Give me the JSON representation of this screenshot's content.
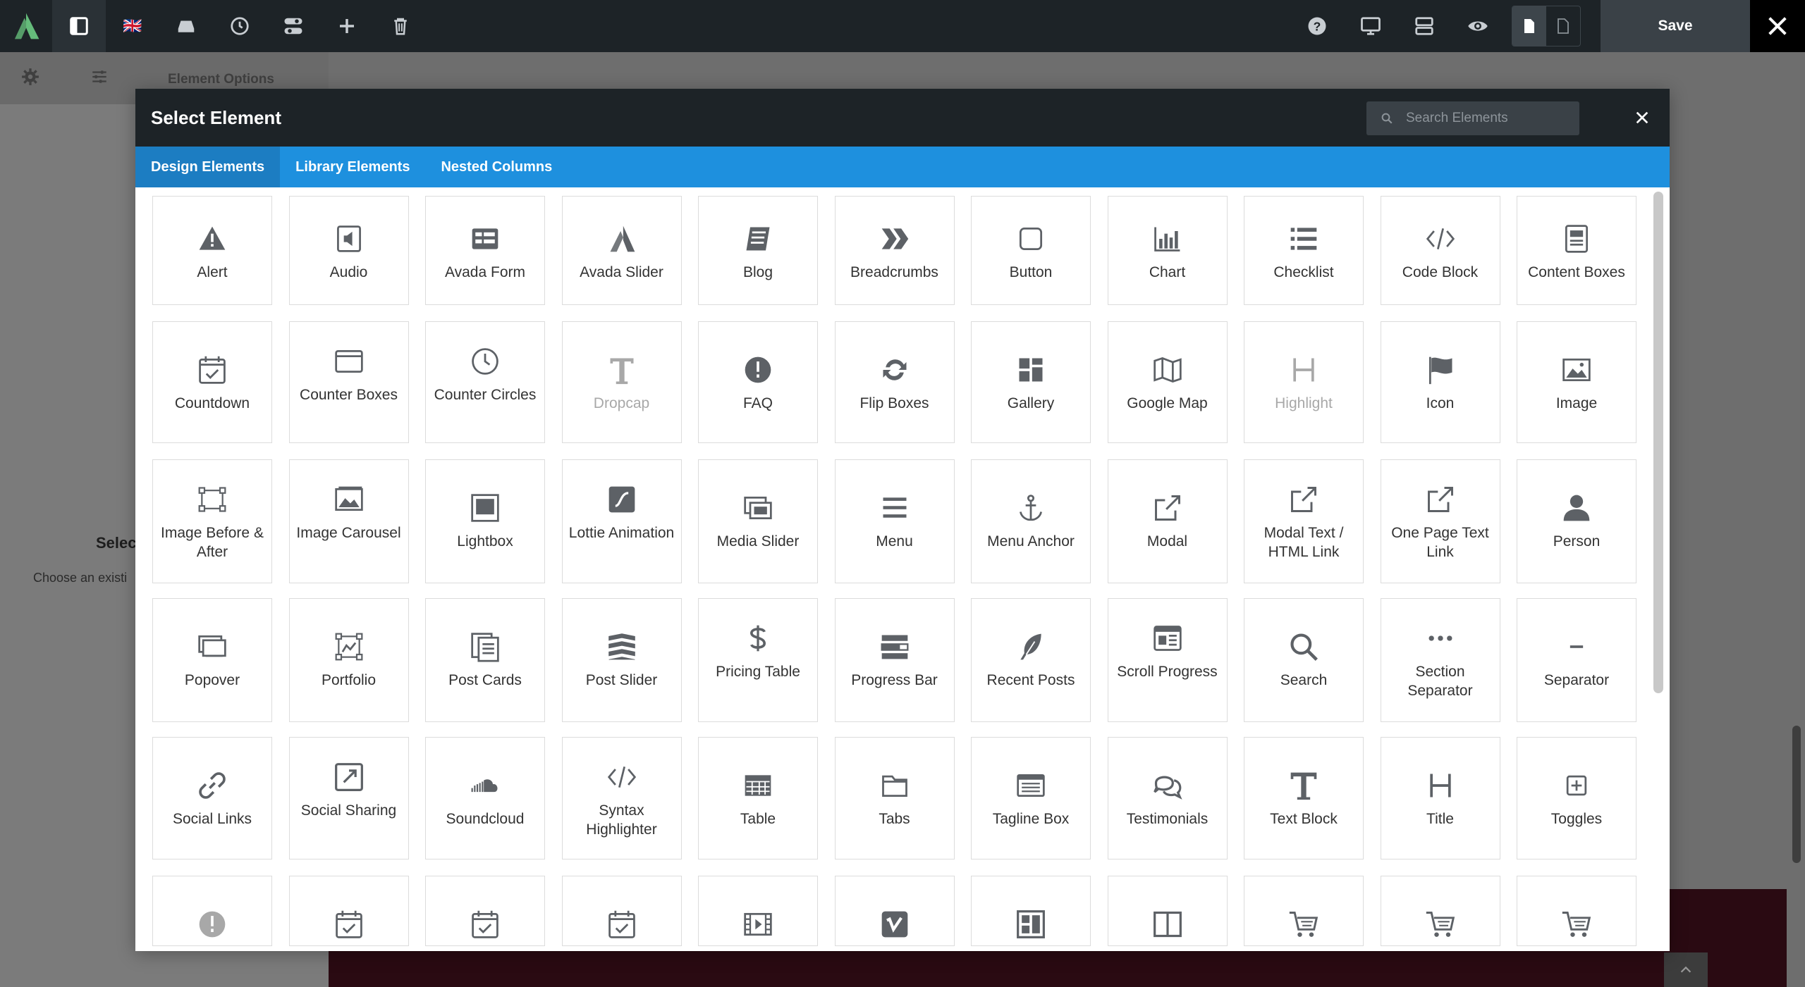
{
  "toolbar": {
    "language": "🇬🇧",
    "save_label": "Save"
  },
  "background": {
    "element_options_label": "Element Options",
    "select_heading": "Selec",
    "choose_text": "Choose an existi"
  },
  "modal": {
    "title": "Select Element",
    "search_placeholder": "Search Elements",
    "tabs": [
      "Design Elements",
      "Library Elements",
      "Nested Columns"
    ],
    "elements": [
      {
        "label": "Alert",
        "icon": "alert-icon"
      },
      {
        "label": "Audio",
        "icon": "audio-icon"
      },
      {
        "label": "Avada Form",
        "icon": "form-icon"
      },
      {
        "label": "Avada Slider",
        "icon": "avada-logo-icon"
      },
      {
        "label": "Blog",
        "icon": "blog-icon"
      },
      {
        "label": "Breadcrumbs",
        "icon": "breadcrumbs-icon"
      },
      {
        "label": "Button",
        "icon": "button-icon"
      },
      {
        "label": "Chart",
        "icon": "chart-icon"
      },
      {
        "label": "Checklist",
        "icon": "checklist-icon"
      },
      {
        "label": "Code Block",
        "icon": "code-icon"
      },
      {
        "label": "Content Boxes",
        "icon": "content-boxes-icon"
      },
      {
        "label": "Countdown",
        "icon": "calendar-check-icon"
      },
      {
        "label": "Counter Boxes",
        "icon": "window-icon"
      },
      {
        "label": "Counter Circles",
        "icon": "clock-icon"
      },
      {
        "label": "Dropcap",
        "icon": "dropcap-icon",
        "muted": true
      },
      {
        "label": "FAQ",
        "icon": "exclamation-circle-icon"
      },
      {
        "label": "Flip Boxes",
        "icon": "flip-icon"
      },
      {
        "label": "Gallery",
        "icon": "gallery-icon"
      },
      {
        "label": "Google Map",
        "icon": "map-icon"
      },
      {
        "label": "Highlight",
        "icon": "heading-icon",
        "muted": true
      },
      {
        "label": "Icon",
        "icon": "flag-icon"
      },
      {
        "label": "Image",
        "icon": "image-icon"
      },
      {
        "label": "Image Before & After",
        "icon": "before-after-icon"
      },
      {
        "label": "Image Carousel",
        "icon": "image-carousel-icon"
      },
      {
        "label": "Lightbox",
        "icon": "lightbox-icon"
      },
      {
        "label": "Lottie Animation",
        "icon": "lottie-icon"
      },
      {
        "label": "Media Slider",
        "icon": "media-slider-icon"
      },
      {
        "label": "Menu",
        "icon": "menu-icon"
      },
      {
        "label": "Menu Anchor",
        "icon": "anchor-icon"
      },
      {
        "label": "Modal",
        "icon": "external-link-icon"
      },
      {
        "label": "Modal Text / HTML Link",
        "icon": "external-link-icon"
      },
      {
        "label": "One Page Text Link",
        "icon": "external-link-icon"
      },
      {
        "label": "Person",
        "icon": "person-icon"
      },
      {
        "label": "Popover",
        "icon": "popover-icon"
      },
      {
        "label": "Portfolio",
        "icon": "portfolio-icon"
      },
      {
        "label": "Post Cards",
        "icon": "post-cards-icon"
      },
      {
        "label": "Post Slider",
        "icon": "post-slider-icon"
      },
      {
        "label": "Pricing Table",
        "icon": "dollar-icon"
      },
      {
        "label": "Progress Bar",
        "icon": "progress-bar-icon"
      },
      {
        "label": "Recent Posts",
        "icon": "feather-icon"
      },
      {
        "label": "Scroll Progress",
        "icon": "scroll-progress-icon"
      },
      {
        "label": "Search",
        "icon": "search-icon"
      },
      {
        "label": "Section Separator",
        "icon": "dots-icon"
      },
      {
        "label": "Separator",
        "icon": "minus-icon"
      },
      {
        "label": "Social Links",
        "icon": "link-icon"
      },
      {
        "label": "Social Sharing",
        "icon": "share-icon"
      },
      {
        "label": "Soundcloud",
        "icon": "soundcloud-icon"
      },
      {
        "label": "Syntax Highlighter",
        "icon": "code-icon"
      },
      {
        "label": "Table",
        "icon": "table-icon"
      },
      {
        "label": "Tabs",
        "icon": "folder-icon"
      },
      {
        "label": "Tagline Box",
        "icon": "tagline-icon"
      },
      {
        "label": "Testimonials",
        "icon": "comments-icon"
      },
      {
        "label": "Text Block",
        "icon": "text-icon"
      },
      {
        "label": "Title",
        "icon": "heading-icon"
      },
      {
        "label": "Toggles",
        "icon": "plus-square-icon"
      },
      {
        "label": "",
        "icon": "exclamation-circle-icon",
        "muted": true
      },
      {
        "label": "",
        "icon": "calendar-check-icon"
      },
      {
        "label": "",
        "icon": "calendar-check-icon"
      },
      {
        "label": "",
        "icon": "calendar-check-icon"
      },
      {
        "label": "",
        "icon": "video-icon"
      },
      {
        "label": "",
        "icon": "vimeo-icon"
      },
      {
        "label": "",
        "icon": "layout-icon"
      },
      {
        "label": "",
        "icon": "columns-icon"
      },
      {
        "label": "",
        "icon": "cart-icon"
      },
      {
        "label": "",
        "icon": "cart-icon"
      },
      {
        "label": "",
        "icon": "cart-icon"
      }
    ]
  }
}
